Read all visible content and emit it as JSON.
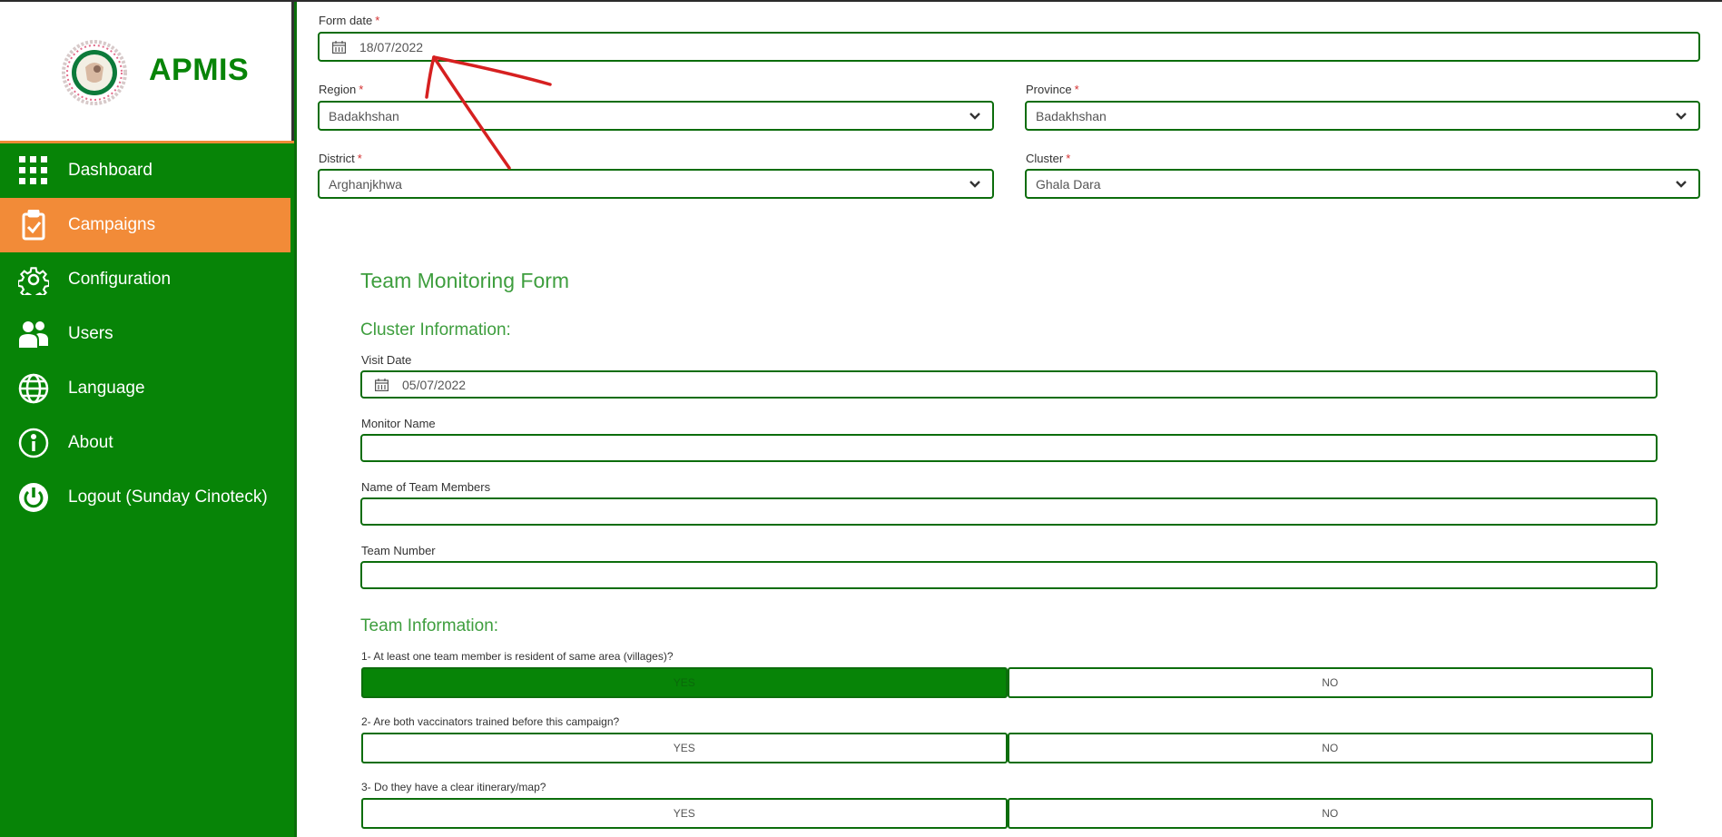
{
  "app": {
    "name": "APMIS"
  },
  "nav": [
    {
      "label": "Dashboard",
      "icon": "grid-icon"
    },
    {
      "label": "Campaigns",
      "icon": "clipboard-check-icon",
      "active": true
    },
    {
      "label": "Configuration",
      "icon": "gear-icon"
    },
    {
      "label": "Users",
      "icon": "users-icon"
    },
    {
      "label": "Language",
      "icon": "globe-icon"
    },
    {
      "label": "About",
      "icon": "info-icon"
    },
    {
      "label": "Logout (Sunday Cinoteck)",
      "icon": "power-icon"
    }
  ],
  "header_form": {
    "form_date": {
      "label": "Form date",
      "value": "18/07/2022"
    },
    "region": {
      "label": "Region",
      "value": "Badakhshan"
    },
    "province": {
      "label": "Province",
      "value": "Badakhshan"
    },
    "district": {
      "label": "District",
      "value": "Arghanjkhwa"
    },
    "cluster": {
      "label": "Cluster",
      "value": "Ghala Dara"
    }
  },
  "form": {
    "title": "Team Monitoring Form",
    "cluster_section": {
      "heading": "Cluster Information:",
      "visit_date": {
        "label": "Visit Date",
        "value": "05/07/2022"
      },
      "monitor_name": {
        "label": "Monitor Name",
        "value": ""
      },
      "team_members": {
        "label": "Name of Team Members",
        "value": ""
      },
      "team_number": {
        "label": "Team Number",
        "value": ""
      }
    },
    "team_section": {
      "heading": "Team Information:",
      "questions": [
        {
          "text": "1- At least one team member is resident of same area (villages)?",
          "yes": "YES",
          "no": "NO",
          "selected": "YES"
        },
        {
          "text": "2- Are both vaccinators trained before this campaign?",
          "yes": "YES",
          "no": "NO",
          "selected": ""
        },
        {
          "text": "3- Do they have a clear itinerary/map?",
          "yes": "YES",
          "no": "NO",
          "selected": ""
        }
      ]
    }
  },
  "colors": {
    "primary_green": "#078407",
    "accent_orange": "#f28b38",
    "heading_green": "#3e9e3e",
    "annotation_red": "#d62020"
  }
}
